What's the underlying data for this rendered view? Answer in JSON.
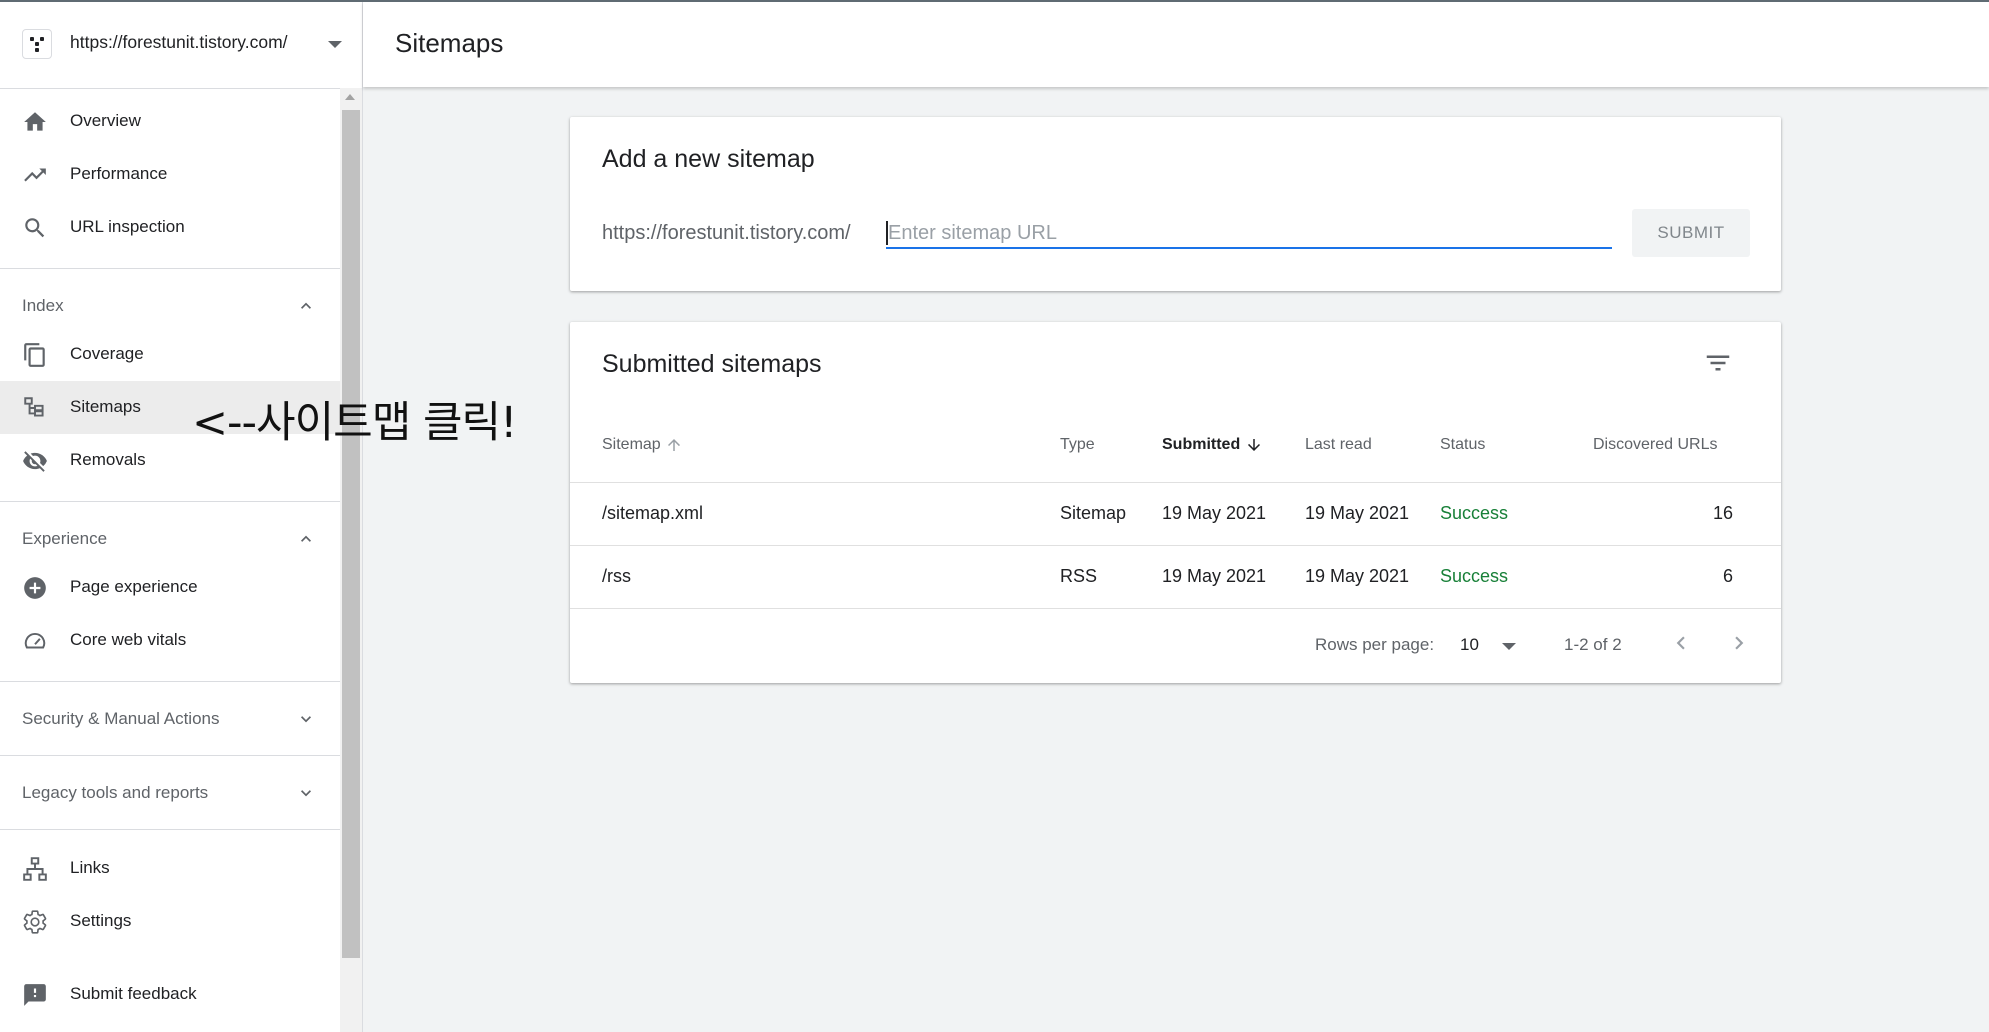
{
  "property": {
    "url": "https://forestunit.tistory.com/"
  },
  "header": {
    "title": "Sitemaps"
  },
  "sidebar": {
    "top_items": [
      {
        "label": "Overview",
        "icon": "home-icon"
      },
      {
        "label": "Performance",
        "icon": "trending-up-icon"
      },
      {
        "label": "URL inspection",
        "icon": "search-icon"
      }
    ],
    "index": {
      "label": "Index",
      "items": [
        {
          "label": "Coverage",
          "icon": "copy-icon"
        },
        {
          "label": "Sitemaps",
          "icon": "sitemap-icon",
          "active": true
        },
        {
          "label": "Removals",
          "icon": "eye-off-icon"
        }
      ]
    },
    "experience": {
      "label": "Experience",
      "items": [
        {
          "label": "Page experience",
          "icon": "add-circle-icon"
        },
        {
          "label": "Core web vitals",
          "icon": "speedometer-icon"
        }
      ]
    },
    "security": {
      "label": "Security & Manual Actions"
    },
    "legacy": {
      "label": "Legacy tools and reports"
    },
    "bottom_items": [
      {
        "label": "Links",
        "icon": "links-icon"
      },
      {
        "label": "Settings",
        "icon": "gear-icon"
      }
    ],
    "feedback": {
      "label": "Submit feedback",
      "icon": "feedback-icon"
    }
  },
  "annotation": "<--사이트맵 클릭!",
  "add_sitemap": {
    "title": "Add a new sitemap",
    "prefix": "https://forestunit.tistory.com/",
    "placeholder": "Enter sitemap URL",
    "value": "",
    "submit_label": "SUBMIT"
  },
  "submitted": {
    "title": "Submitted sitemaps",
    "columns": {
      "sitemap": "Sitemap",
      "type": "Type",
      "submitted": "Submitted",
      "last_read": "Last read",
      "status": "Status",
      "discovered": "Discovered URLs"
    },
    "rows": [
      {
        "sitemap": "/sitemap.xml",
        "type": "Sitemap",
        "submitted": "19 May 2021",
        "last_read": "19 May 2021",
        "status": "Success",
        "discovered": "16"
      },
      {
        "sitemap": "/rss",
        "type": "RSS",
        "submitted": "19 May 2021",
        "last_read": "19 May 2021",
        "status": "Success",
        "discovered": "6"
      }
    ],
    "pagination": {
      "rows_per_page_label": "Rows per page:",
      "rows_per_page": "10",
      "range": "1-2 of 2"
    }
  },
  "colors": {
    "accent": "#1a73e8",
    "success": "#188038",
    "active_nav_bg": "#ececec"
  }
}
